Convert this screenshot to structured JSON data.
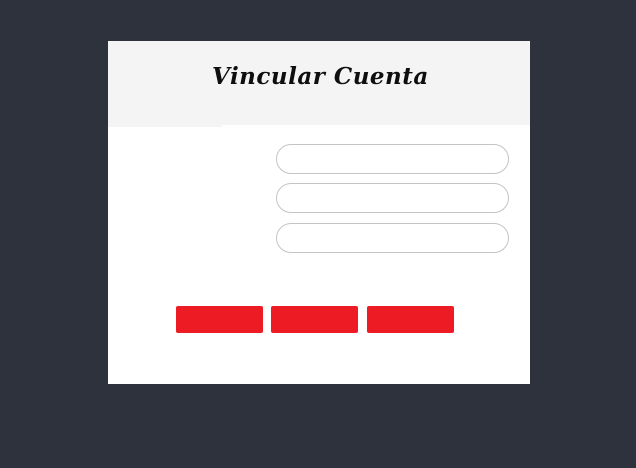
{
  "dialog": {
    "title": "Vincular Cuenta",
    "fields": [
      {
        "value": "",
        "placeholder": ""
      },
      {
        "value": "",
        "placeholder": ""
      },
      {
        "value": "",
        "placeholder": ""
      }
    ],
    "buttons": [
      {
        "label": ""
      },
      {
        "label": ""
      },
      {
        "label": ""
      }
    ]
  },
  "colors": {
    "background": "#2d323d",
    "header": "#f4f4f4",
    "button": "#ed1c24",
    "field_border": "#c4c4c4"
  }
}
